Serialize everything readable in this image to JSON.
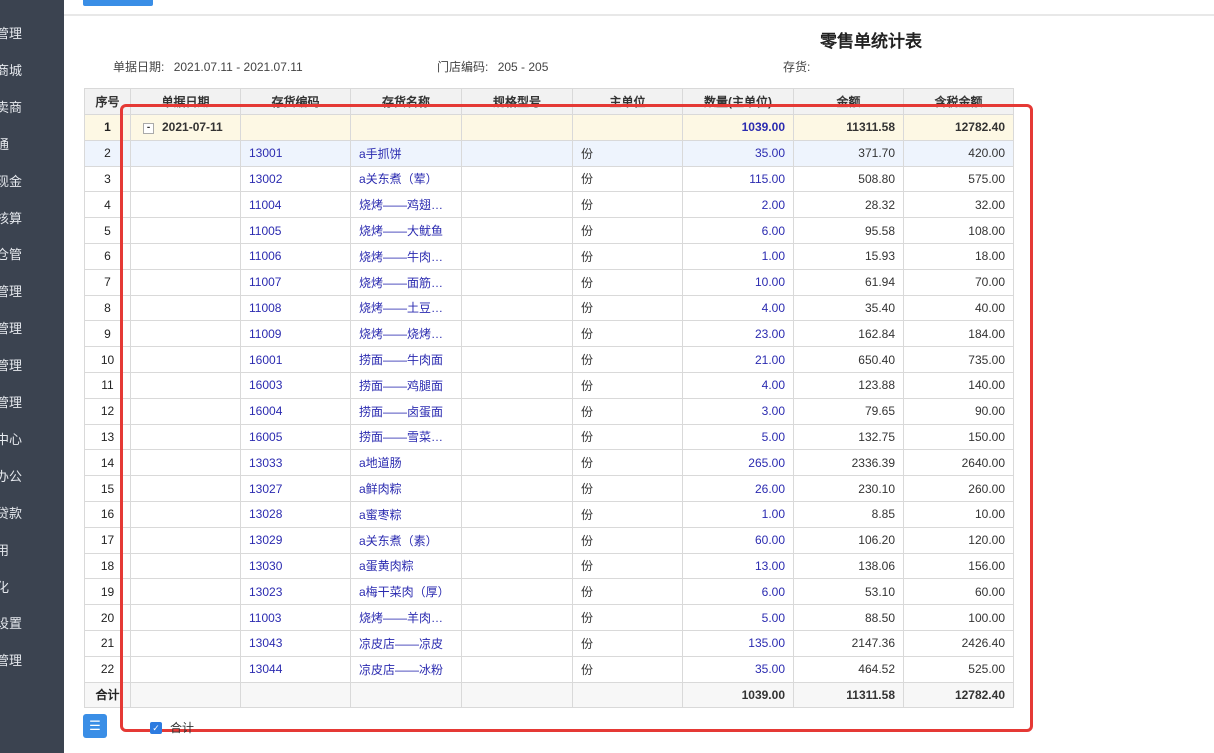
{
  "sidebar": {
    "items": [
      "管理",
      "商城",
      "卖商",
      "通",
      "现金",
      "核算",
      "仓管",
      "管理",
      "管理",
      "管理",
      "管理",
      "中心",
      "办公",
      "贷款",
      "用",
      "化",
      "设置",
      "管理"
    ]
  },
  "report": {
    "title": "零售单统计表",
    "filters": {
      "date_label": "单据日期:",
      "date_value": "2021.07.11 - 2021.07.11",
      "store_label": "门店编码:",
      "store_value": "205 - 205",
      "stock_label": "存货:"
    }
  },
  "table": {
    "headers": [
      "序号",
      "单据日期",
      "存货编码",
      "存货名称",
      "规格型号",
      "主单位",
      "数量(主单位)",
      "金额",
      "含税金额"
    ],
    "group": {
      "seq": "1",
      "toggle": "-",
      "date": "2021-07-11",
      "qty": "1039.00",
      "amount": "11311.58",
      "tax_amount": "12782.40"
    },
    "rows": [
      {
        "seq": "2",
        "code": "13001",
        "name": "a手抓饼",
        "unit": "份",
        "qty": "35.00",
        "amount": "371.70",
        "tax_amount": "420.00"
      },
      {
        "seq": "3",
        "code": "13002",
        "name": "a关东煮（荤）",
        "unit": "份",
        "qty": "115.00",
        "amount": "508.80",
        "tax_amount": "575.00"
      },
      {
        "seq": "4",
        "code": "11004",
        "name": "烧烤——鸡翅…",
        "unit": "份",
        "qty": "2.00",
        "amount": "28.32",
        "tax_amount": "32.00"
      },
      {
        "seq": "5",
        "code": "11005",
        "name": "烧烤——大鱿鱼",
        "unit": "份",
        "qty": "6.00",
        "amount": "95.58",
        "tax_amount": "108.00"
      },
      {
        "seq": "6",
        "code": "11006",
        "name": "烧烤——牛肉…",
        "unit": "份",
        "qty": "1.00",
        "amount": "15.93",
        "tax_amount": "18.00"
      },
      {
        "seq": "7",
        "code": "11007",
        "name": "烧烤——面筋…",
        "unit": "份",
        "qty": "10.00",
        "amount": "61.94",
        "tax_amount": "70.00"
      },
      {
        "seq": "8",
        "code": "11008",
        "name": "烧烤——土豆…",
        "unit": "份",
        "qty": "4.00",
        "amount": "35.40",
        "tax_amount": "40.00"
      },
      {
        "seq": "9",
        "code": "11009",
        "name": "烧烤——烧烤…",
        "unit": "份",
        "qty": "23.00",
        "amount": "162.84",
        "tax_amount": "184.00"
      },
      {
        "seq": "10",
        "code": "16001",
        "name": "捞面——牛肉面",
        "unit": "份",
        "qty": "21.00",
        "amount": "650.40",
        "tax_amount": "735.00"
      },
      {
        "seq": "11",
        "code": "16003",
        "name": "捞面——鸡腿面",
        "unit": "份",
        "qty": "4.00",
        "amount": "123.88",
        "tax_amount": "140.00"
      },
      {
        "seq": "12",
        "code": "16004",
        "name": "捞面——卤蛋面",
        "unit": "份",
        "qty": "3.00",
        "amount": "79.65",
        "tax_amount": "90.00"
      },
      {
        "seq": "13",
        "code": "16005",
        "name": "捞面——雪菜…",
        "unit": "份",
        "qty": "5.00",
        "amount": "132.75",
        "tax_amount": "150.00"
      },
      {
        "seq": "14",
        "code": "13033",
        "name": "a地道肠",
        "unit": "份",
        "qty": "265.00",
        "amount": "2336.39",
        "tax_amount": "2640.00"
      },
      {
        "seq": "15",
        "code": "13027",
        "name": "a鲜肉粽",
        "unit": "份",
        "qty": "26.00",
        "amount": "230.10",
        "tax_amount": "260.00"
      },
      {
        "seq": "16",
        "code": "13028",
        "name": "a蜜枣粽",
        "unit": "份",
        "qty": "1.00",
        "amount": "8.85",
        "tax_amount": "10.00"
      },
      {
        "seq": "17",
        "code": "13029",
        "name": "a关东煮（素）",
        "unit": "份",
        "qty": "60.00",
        "amount": "106.20",
        "tax_amount": "120.00"
      },
      {
        "seq": "18",
        "code": "13030",
        "name": "a蛋黄肉粽",
        "unit": "份",
        "qty": "13.00",
        "amount": "138.06",
        "tax_amount": "156.00"
      },
      {
        "seq": "19",
        "code": "13023",
        "name": "a梅干菜肉（厚）",
        "unit": "份",
        "qty": "6.00",
        "amount": "53.10",
        "tax_amount": "60.00"
      },
      {
        "seq": "20",
        "code": "11003",
        "name": "烧烤——羊肉…",
        "unit": "份",
        "qty": "5.00",
        "amount": "88.50",
        "tax_amount": "100.00"
      },
      {
        "seq": "21",
        "code": "13043",
        "name": "凉皮店——凉皮",
        "unit": "份",
        "qty": "135.00",
        "amount": "2147.36",
        "tax_amount": "2426.40"
      },
      {
        "seq": "22",
        "code": "13044",
        "name": "凉皮店——冰粉",
        "unit": "份",
        "qty": "35.00",
        "amount": "464.52",
        "tax_amount": "525.00"
      }
    ],
    "total": {
      "label": "合计",
      "qty": "1039.00",
      "amount": "11311.58",
      "tax_amount": "12782.40"
    }
  },
  "footer": {
    "menu_icon": "list-menu-icon",
    "menu_glyph": "☰",
    "check_glyph": "✓",
    "total_checkbox_label": "合计"
  },
  "colors": {
    "sidebar_bg": "#3b4350",
    "accent": "#3a8ee6",
    "highlight": "#e53935",
    "link": "#2b2bb0"
  }
}
